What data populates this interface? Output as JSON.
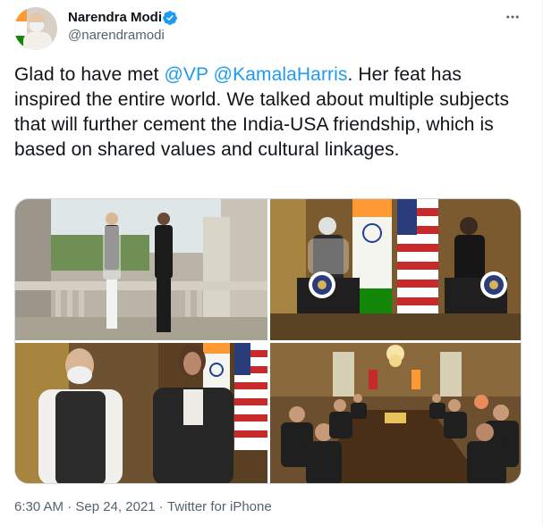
{
  "author": {
    "name": "Narendra Modi",
    "handle": "@narendramodi",
    "verified": true,
    "avatar_icon": "avatar-photo"
  },
  "tweet": {
    "text_part1": "Glad to have met ",
    "mention_vp": "@VP",
    "space": " ",
    "mention_kh": "@KamalaHarris",
    "text_part2": ". Her feat has inspired the entire world. We talked about multiple subjects that will further cement the India-USA friendship, which is based on shared values and cultural linkages."
  },
  "media": {
    "photos": [
      "photo-balcony",
      "photo-podiums",
      "photo-portrait",
      "photo-meeting-table"
    ]
  },
  "meta": {
    "time": "6:30 AM",
    "separator1": " · ",
    "date": "Sep 24, 2021",
    "separator2": " · ",
    "source": "Twitter for iPhone"
  },
  "colors": {
    "accent": "#1d9bf0",
    "text": "#0f1419",
    "muted": "#536471"
  }
}
